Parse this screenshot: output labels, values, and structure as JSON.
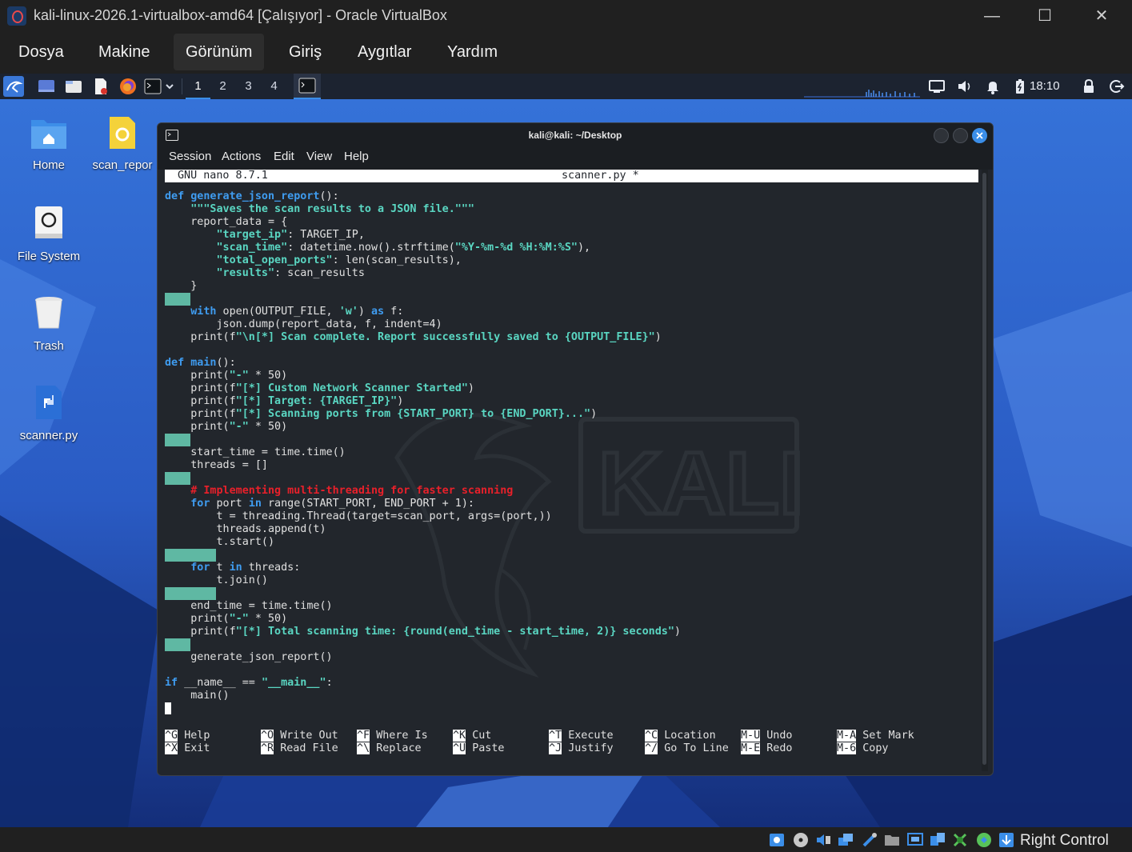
{
  "host": {
    "title": "kali-linux-2026.1-virtualbox-amd64 [Çalışıyor] - Oracle VirtualBox",
    "menu": [
      "Dosya",
      "Makine",
      "Görünüm",
      "Giriş",
      "Aygıtlar",
      "Yardım"
    ],
    "active_menu": "Görünüm",
    "window_controls": {
      "minimize": "—",
      "maximize": "☐",
      "close": "✕"
    },
    "host_key": "Right Control"
  },
  "panel": {
    "workspaces": [
      "1",
      "2",
      "3",
      "4"
    ],
    "active_workspace": "1",
    "clock": "18:10"
  },
  "desktop": {
    "icons": [
      {
        "label": "Home",
        "icon": "home-folder-icon"
      },
      {
        "label": "scan_repor",
        "icon": "json-file-icon"
      },
      {
        "label": "File System",
        "icon": "drive-icon"
      },
      {
        "label": "Trash",
        "icon": "trash-icon"
      },
      {
        "label": "scanner.py",
        "icon": "python-file-icon"
      }
    ],
    "watermark": "KALI"
  },
  "terminal": {
    "title": "kali@kali: ~/Desktop",
    "menu": [
      "Session",
      "Actions",
      "Edit",
      "View",
      "Help"
    ],
    "nano": {
      "version": "GNU nano 8.7.1",
      "filename": "scanner.py *",
      "lines": [
        [
          [
            "kw",
            "def "
          ],
          [
            "fn",
            "generate_json_report"
          ],
          [
            "n",
            "():"
          ]
        ],
        [
          [
            "n",
            "    "
          ],
          [
            "st",
            "\"\"\"Saves the scan results to a JSON file.\"\"\""
          ]
        ],
        [
          [
            "n",
            "    report_data = {"
          ]
        ],
        [
          [
            "n",
            "        "
          ],
          [
            "st",
            "\"target_ip\""
          ],
          [
            "n",
            ": TARGET_IP,"
          ]
        ],
        [
          [
            "n",
            "        "
          ],
          [
            "st",
            "\"scan_time\""
          ],
          [
            "n",
            ": datetime.now().strftime("
          ],
          [
            "st",
            "\"%Y-%m-%d %H:%M:%S\""
          ],
          [
            "n",
            "),"
          ]
        ],
        [
          [
            "n",
            "        "
          ],
          [
            "st",
            "\"total_open_ports\""
          ],
          [
            "n",
            ": len(scan_results),"
          ]
        ],
        [
          [
            "n",
            "        "
          ],
          [
            "st",
            "\"results\""
          ],
          [
            "n",
            ": scan_results"
          ]
        ],
        [
          [
            "n",
            "    }"
          ]
        ],
        [
          [
            "n",
            ""
          ]
        ],
        [
          [
            "n",
            "    "
          ],
          [
            "kw",
            "with"
          ],
          [
            "n",
            " open(OUTPUT_FILE, "
          ],
          [
            "st",
            "'w'"
          ],
          [
            "n",
            ") "
          ],
          [
            "kw",
            "as"
          ],
          [
            "n",
            " f:"
          ]
        ],
        [
          [
            "n",
            "        json.dump(report_data, f, indent=4)"
          ]
        ],
        [
          [
            "n",
            "    print(f"
          ],
          [
            "st",
            "\"\\n[*] Scan complete. Report successfully saved to {OUTPUT_FILE}\""
          ],
          [
            "n",
            ")"
          ]
        ],
        [
          [
            "n",
            ""
          ]
        ],
        [
          [
            "kw",
            "def "
          ],
          [
            "fn",
            "main"
          ],
          [
            "n",
            "():"
          ]
        ],
        [
          [
            "n",
            "    print("
          ],
          [
            "st",
            "\"-\""
          ],
          [
            "n",
            " * 50)"
          ]
        ],
        [
          [
            "n",
            "    print(f"
          ],
          [
            "st",
            "\"[*] Custom Network Scanner Started\""
          ],
          [
            "n",
            ")"
          ]
        ],
        [
          [
            "n",
            "    print(f"
          ],
          [
            "st",
            "\"[*] Target: {TARGET_IP}\""
          ],
          [
            "n",
            ")"
          ]
        ],
        [
          [
            "n",
            "    print(f"
          ],
          [
            "st",
            "\"[*] Scanning ports from {START_PORT} to {END_PORT}...\""
          ],
          [
            "n",
            ")"
          ]
        ],
        [
          [
            "n",
            "    print("
          ],
          [
            "st",
            "\"-\""
          ],
          [
            "n",
            " * 50)"
          ]
        ],
        [
          [
            "n",
            ""
          ]
        ],
        [
          [
            "n",
            "    start_time = time.time()"
          ]
        ],
        [
          [
            "n",
            "    threads = []"
          ]
        ],
        [
          [
            "n",
            ""
          ]
        ],
        [
          [
            "n",
            "    "
          ],
          [
            "cm",
            "# Implementing multi-threading for faster scanning"
          ]
        ],
        [
          [
            "n",
            "    "
          ],
          [
            "kw",
            "for"
          ],
          [
            "n",
            " port "
          ],
          [
            "kw",
            "in"
          ],
          [
            "n",
            " range(START_PORT, END_PORT + 1):"
          ]
        ],
        [
          [
            "n",
            "        t = threading.Thread(target=scan_port, args=(port,))"
          ]
        ],
        [
          [
            "n",
            "        threads.append(t)"
          ]
        ],
        [
          [
            "n",
            "        t.start()"
          ]
        ],
        [
          [
            "n",
            ""
          ]
        ],
        [
          [
            "n",
            "    "
          ],
          [
            "kw",
            "for"
          ],
          [
            "n",
            " t "
          ],
          [
            "kw",
            "in"
          ],
          [
            "n",
            " threads:"
          ]
        ],
        [
          [
            "n",
            "        t.join()"
          ]
        ],
        [
          [
            "n",
            ""
          ]
        ],
        [
          [
            "n",
            "    end_time = time.time()"
          ]
        ],
        [
          [
            "n",
            "    print("
          ],
          [
            "st",
            "\"-\""
          ],
          [
            "n",
            " * 50)"
          ]
        ],
        [
          [
            "n",
            "    print(f"
          ],
          [
            "st",
            "\"[*] Total scanning time: {round(end_time - start_time, 2)} seconds\""
          ],
          [
            "n",
            ")"
          ]
        ],
        [
          [
            "n",
            ""
          ]
        ],
        [
          [
            "n",
            "    generate_json_report()"
          ]
        ],
        [
          [
            "n",
            ""
          ]
        ],
        [
          [
            "kw",
            "if"
          ],
          [
            "n",
            " __name__ == "
          ],
          [
            "st",
            "\"__main__\""
          ],
          [
            "n",
            ":"
          ]
        ],
        [
          [
            "n",
            "    main()"
          ]
        ]
      ],
      "shortcuts": [
        [
          {
            "key": "^G",
            "label": "Help"
          },
          {
            "key": "^X",
            "label": "Exit"
          }
        ],
        [
          {
            "key": "^O",
            "label": "Write Out"
          },
          {
            "key": "^R",
            "label": "Read File"
          }
        ],
        [
          {
            "key": "^F",
            "label": "Where Is"
          },
          {
            "key": "^\\",
            "label": "Replace"
          }
        ],
        [
          {
            "key": "^K",
            "label": "Cut"
          },
          {
            "key": "^U",
            "label": "Paste"
          }
        ],
        [
          {
            "key": "^T",
            "label": "Execute"
          },
          {
            "key": "^J",
            "label": "Justify"
          }
        ],
        [
          {
            "key": "^C",
            "label": "Location"
          },
          {
            "key": "^/",
            "label": "Go To Line"
          }
        ],
        [
          {
            "key": "M-U",
            "label": "Undo"
          },
          {
            "key": "M-E",
            "label": "Redo"
          }
        ],
        [
          {
            "key": "M-A",
            "label": "Set Mark"
          },
          {
            "key": "M-6",
            "label": "Copy"
          }
        ]
      ]
    }
  }
}
